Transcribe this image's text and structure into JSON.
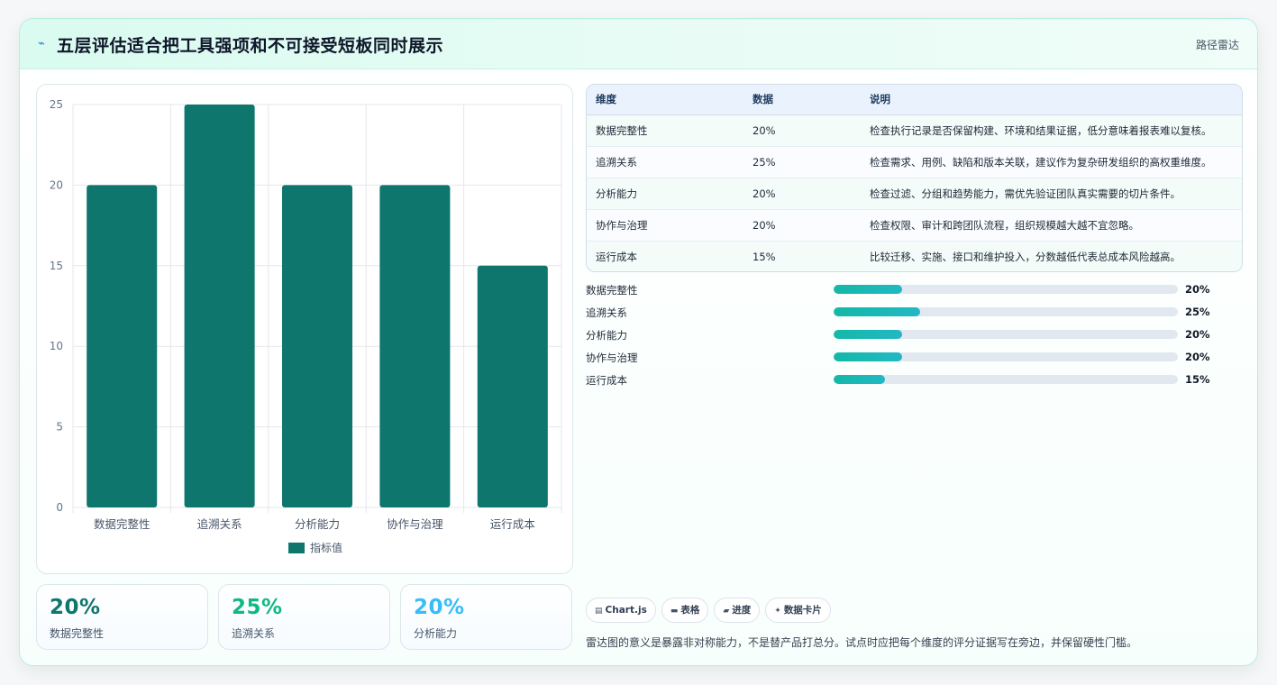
{
  "header": {
    "icon": "pulse-icon",
    "title": "五层评估适合把工具强项和不可接受短板同时展示",
    "tag": "路径雷达"
  },
  "chart_data": {
    "type": "bar",
    "categories": [
      "数据完整性",
      "追溯关系",
      "分析能力",
      "协作与治理",
      "运行成本"
    ],
    "series": [
      {
        "name": "指标值",
        "values": [
          20,
          25,
          20,
          20,
          15
        ],
        "color": "#0f766e"
      }
    ],
    "ylim": [
      0,
      25
    ],
    "yticks": [
      0,
      5,
      10,
      15,
      20,
      25
    ],
    "grid": true,
    "legend": "bottom"
  },
  "stats": [
    {
      "value": "20%",
      "label": "数据完整性",
      "color": "#0f766e"
    },
    {
      "value": "25%",
      "label": "追溯关系",
      "color": "#10b981"
    },
    {
      "value": "20%",
      "label": "分析能力",
      "color": "#38bdf8"
    }
  ],
  "table": {
    "headers": [
      "维度",
      "数据",
      "说明"
    ],
    "rows": [
      [
        "数据完整性",
        "20%",
        "检查执行记录是否保留构建、环境和结果证据，低分意味着报表难以复核。"
      ],
      [
        "追溯关系",
        "25%",
        "检查需求、用例、缺陷和版本关联，建议作为复杂研发组织的高权重维度。"
      ],
      [
        "分析能力",
        "20%",
        "检查过滤、分组和趋势能力，需优先验证团队真实需要的切片条件。"
      ],
      [
        "协作与治理",
        "20%",
        "检查权限、审计和跨团队流程，组织规模越大越不宜忽略。"
      ],
      [
        "运行成本",
        "15%",
        "比较迁移、实施、接口和维护投入，分数越低代表总成本风险越高。"
      ]
    ]
  },
  "progress": [
    {
      "label": "数据完整性",
      "value": 20,
      "text": "20%"
    },
    {
      "label": "追溯关系",
      "value": 25,
      "text": "25%"
    },
    {
      "label": "分析能力",
      "value": 20,
      "text": "20%"
    },
    {
      "label": "协作与治理",
      "value": 20,
      "text": "20%"
    },
    {
      "label": "运行成本",
      "value": 15,
      "text": "15%"
    }
  ],
  "chips": [
    {
      "icon": "chart-icon",
      "glyph": "▤",
      "label": "Chart.js"
    },
    {
      "icon": "table-icon",
      "glyph": "▬",
      "label": "表格"
    },
    {
      "icon": "progress-icon",
      "glyph": "▰",
      "label": "进度"
    },
    {
      "icon": "sparkle-icon",
      "glyph": "✦",
      "label": "数据卡片"
    }
  ],
  "note": "雷达图的意义是暴露非对称能力，不是替产品打总分。试点时应把每个维度的评分证据写在旁边，并保留硬性门槛。"
}
